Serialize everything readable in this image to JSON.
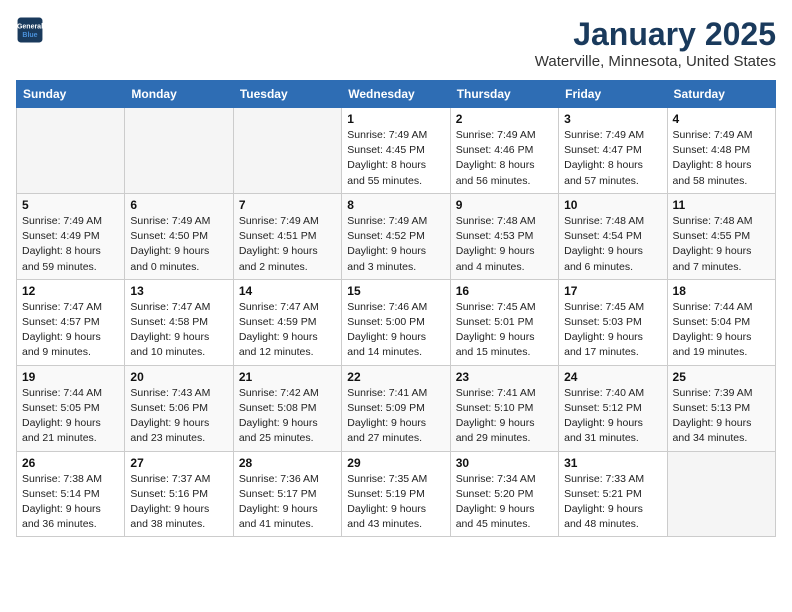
{
  "logo": {
    "line1": "General",
    "line2": "Blue"
  },
  "title": "January 2025",
  "subtitle": "Waterville, Minnesota, United States",
  "headers": [
    "Sunday",
    "Monday",
    "Tuesday",
    "Wednesday",
    "Thursday",
    "Friday",
    "Saturday"
  ],
  "weeks": [
    [
      {
        "day": "",
        "info": ""
      },
      {
        "day": "",
        "info": ""
      },
      {
        "day": "",
        "info": ""
      },
      {
        "day": "1",
        "info": "Sunrise: 7:49 AM\nSunset: 4:45 PM\nDaylight: 8 hours\nand 55 minutes."
      },
      {
        "day": "2",
        "info": "Sunrise: 7:49 AM\nSunset: 4:46 PM\nDaylight: 8 hours\nand 56 minutes."
      },
      {
        "day": "3",
        "info": "Sunrise: 7:49 AM\nSunset: 4:47 PM\nDaylight: 8 hours\nand 57 minutes."
      },
      {
        "day": "4",
        "info": "Sunrise: 7:49 AM\nSunset: 4:48 PM\nDaylight: 8 hours\nand 58 minutes."
      }
    ],
    [
      {
        "day": "5",
        "info": "Sunrise: 7:49 AM\nSunset: 4:49 PM\nDaylight: 8 hours\nand 59 minutes."
      },
      {
        "day": "6",
        "info": "Sunrise: 7:49 AM\nSunset: 4:50 PM\nDaylight: 9 hours\nand 0 minutes."
      },
      {
        "day": "7",
        "info": "Sunrise: 7:49 AM\nSunset: 4:51 PM\nDaylight: 9 hours\nand 2 minutes."
      },
      {
        "day": "8",
        "info": "Sunrise: 7:49 AM\nSunset: 4:52 PM\nDaylight: 9 hours\nand 3 minutes."
      },
      {
        "day": "9",
        "info": "Sunrise: 7:48 AM\nSunset: 4:53 PM\nDaylight: 9 hours\nand 4 minutes."
      },
      {
        "day": "10",
        "info": "Sunrise: 7:48 AM\nSunset: 4:54 PM\nDaylight: 9 hours\nand 6 minutes."
      },
      {
        "day": "11",
        "info": "Sunrise: 7:48 AM\nSunset: 4:55 PM\nDaylight: 9 hours\nand 7 minutes."
      }
    ],
    [
      {
        "day": "12",
        "info": "Sunrise: 7:47 AM\nSunset: 4:57 PM\nDaylight: 9 hours\nand 9 minutes."
      },
      {
        "day": "13",
        "info": "Sunrise: 7:47 AM\nSunset: 4:58 PM\nDaylight: 9 hours\nand 10 minutes."
      },
      {
        "day": "14",
        "info": "Sunrise: 7:47 AM\nSunset: 4:59 PM\nDaylight: 9 hours\nand 12 minutes."
      },
      {
        "day": "15",
        "info": "Sunrise: 7:46 AM\nSunset: 5:00 PM\nDaylight: 9 hours\nand 14 minutes."
      },
      {
        "day": "16",
        "info": "Sunrise: 7:45 AM\nSunset: 5:01 PM\nDaylight: 9 hours\nand 15 minutes."
      },
      {
        "day": "17",
        "info": "Sunrise: 7:45 AM\nSunset: 5:03 PM\nDaylight: 9 hours\nand 17 minutes."
      },
      {
        "day": "18",
        "info": "Sunrise: 7:44 AM\nSunset: 5:04 PM\nDaylight: 9 hours\nand 19 minutes."
      }
    ],
    [
      {
        "day": "19",
        "info": "Sunrise: 7:44 AM\nSunset: 5:05 PM\nDaylight: 9 hours\nand 21 minutes."
      },
      {
        "day": "20",
        "info": "Sunrise: 7:43 AM\nSunset: 5:06 PM\nDaylight: 9 hours\nand 23 minutes."
      },
      {
        "day": "21",
        "info": "Sunrise: 7:42 AM\nSunset: 5:08 PM\nDaylight: 9 hours\nand 25 minutes."
      },
      {
        "day": "22",
        "info": "Sunrise: 7:41 AM\nSunset: 5:09 PM\nDaylight: 9 hours\nand 27 minutes."
      },
      {
        "day": "23",
        "info": "Sunrise: 7:41 AM\nSunset: 5:10 PM\nDaylight: 9 hours\nand 29 minutes."
      },
      {
        "day": "24",
        "info": "Sunrise: 7:40 AM\nSunset: 5:12 PM\nDaylight: 9 hours\nand 31 minutes."
      },
      {
        "day": "25",
        "info": "Sunrise: 7:39 AM\nSunset: 5:13 PM\nDaylight: 9 hours\nand 34 minutes."
      }
    ],
    [
      {
        "day": "26",
        "info": "Sunrise: 7:38 AM\nSunset: 5:14 PM\nDaylight: 9 hours\nand 36 minutes."
      },
      {
        "day": "27",
        "info": "Sunrise: 7:37 AM\nSunset: 5:16 PM\nDaylight: 9 hours\nand 38 minutes."
      },
      {
        "day": "28",
        "info": "Sunrise: 7:36 AM\nSunset: 5:17 PM\nDaylight: 9 hours\nand 41 minutes."
      },
      {
        "day": "29",
        "info": "Sunrise: 7:35 AM\nSunset: 5:19 PM\nDaylight: 9 hours\nand 43 minutes."
      },
      {
        "day": "30",
        "info": "Sunrise: 7:34 AM\nSunset: 5:20 PM\nDaylight: 9 hours\nand 45 minutes."
      },
      {
        "day": "31",
        "info": "Sunrise: 7:33 AM\nSunset: 5:21 PM\nDaylight: 9 hours\nand 48 minutes."
      },
      {
        "day": "",
        "info": ""
      }
    ]
  ]
}
